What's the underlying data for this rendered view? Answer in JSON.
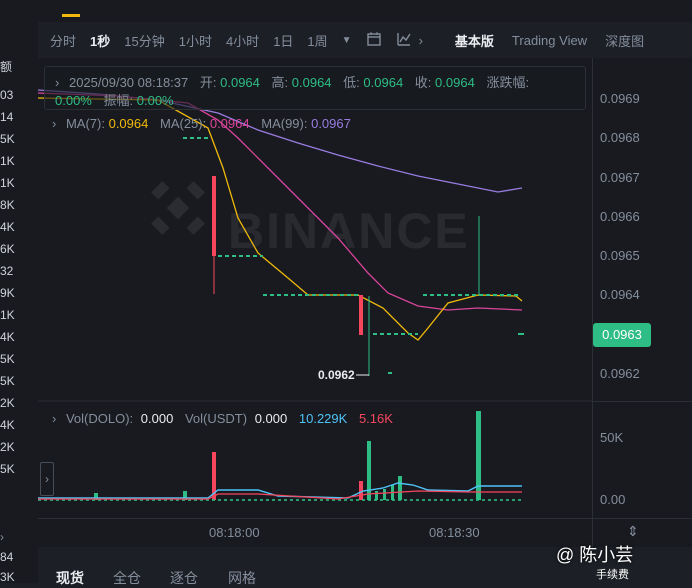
{
  "left_column_values": [
    "额",
    "03",
    "14",
    "5K",
    "1K",
    "1K",
    "8K",
    "4K",
    "6K",
    "32",
    "9K",
    "1K",
    "4K",
    "5K",
    "5K",
    "2K",
    "4K",
    "2K",
    "5K",
    "84",
    "3K"
  ],
  "toolbar": {
    "intervals": [
      "分时",
      "1秒",
      "15分钟",
      "1小时",
      "4小时",
      "1日",
      "1周"
    ],
    "active_interval": "1秒",
    "views": [
      "基本版",
      "Trading View",
      "深度图"
    ],
    "active_view": "基本版"
  },
  "info": {
    "datetime": "2025/09/30 08:18:37",
    "open_label": "开:",
    "open": "0.0964",
    "high_label": "高:",
    "high": "0.0964",
    "low_label": "低:",
    "low": "0.0964",
    "close_label": "收:",
    "close": "0.0964",
    "change_label": "涨跌幅:",
    "change": "0.00%",
    "amplitude_label": "振幅:",
    "amplitude": "0.00%"
  },
  "ma": {
    "ma7_label": "MA(7):",
    "ma7": "0.0964",
    "ma25_label": "MA(25):",
    "ma25": "0.0964",
    "ma99_label": "MA(99):",
    "ma99": "0.0967"
  },
  "volume": {
    "dolo_label": "Vol(DOLO):",
    "dolo": "0.000",
    "usdt_label": "Vol(USDT)",
    "usdt": "0.000",
    "ma1": "10.229K",
    "ma2": "5.16K"
  },
  "y_axis_labels": [
    "0.0969",
    "0.0968",
    "0.0967",
    "0.0966",
    "0.0965",
    "0.0964",
    "0.0962"
  ],
  "current_price": "0.0963",
  "low_marker": "0.0962",
  "vol_axis_labels": [
    "50K",
    "0.00"
  ],
  "x_axis_labels": [
    "08:18:00",
    "08:18:30"
  ],
  "watermark": "BINANCE",
  "bottom_tabs": [
    "现货",
    "全仓",
    "逐仓",
    "网格"
  ],
  "author": "@ 陈小芸",
  "author_sub": "手续费",
  "colors": {
    "up": "#2ebd85",
    "down": "#f6465d",
    "ma7": "#f0b90b",
    "ma25": "#d9459b",
    "ma99": "#9a7ce0",
    "vol_ma1": "#4fc3f7"
  }
}
